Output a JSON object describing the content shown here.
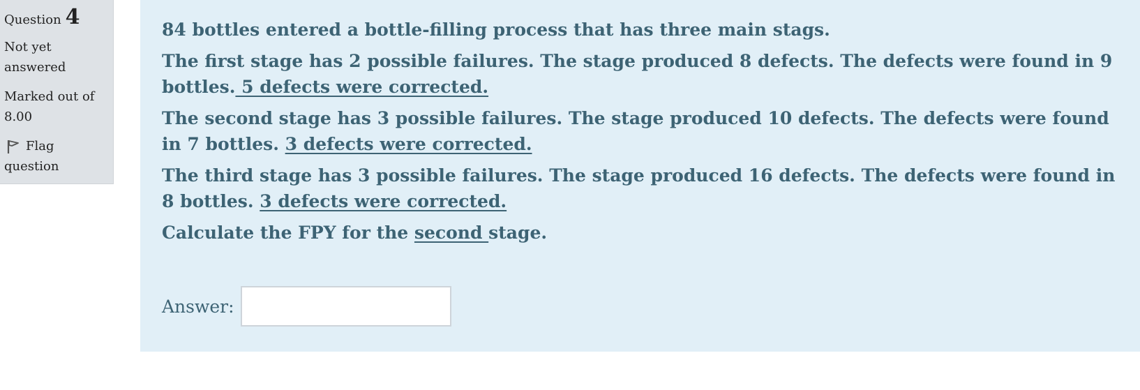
{
  "info": {
    "question_label": "Question",
    "question_number": "4",
    "state_line1": "Not yet",
    "state_line2": "answered",
    "grade_line1": "Marked out of",
    "grade_line2": "8.00",
    "flag_line1": "Flag",
    "flag_line2": "question",
    "flag_icon": "flag-icon"
  },
  "question": {
    "intro": "84 bottles entered a bottle-filling process that has three main stags.",
    "stage1_text": "The first stage has 2  possible failures. The stage produced 8 defects. The defects were found in 9 bottles.",
    "stage1_corrected": " 5 defects were  corrected. ",
    "stage2_text": "The second stage has 3 possible failures.  The stage produced 10 defects. The defects were found in 7 bottles. ",
    "stage2_corrected": " 3 defects were  corrected. ",
    "stage3_text": "The third stage has 3  possible failures. The stage produced 16 defects. The defects were found in 8 bottles. ",
    "stage3_corrected": " 3 defects were  corrected. ",
    "calc_prefix": "Calculate the FPY for the ",
    "calc_emph": "second ",
    "calc_suffix": "stage."
  },
  "answer": {
    "label": "Answer:",
    "value": "",
    "placeholder": ""
  }
}
